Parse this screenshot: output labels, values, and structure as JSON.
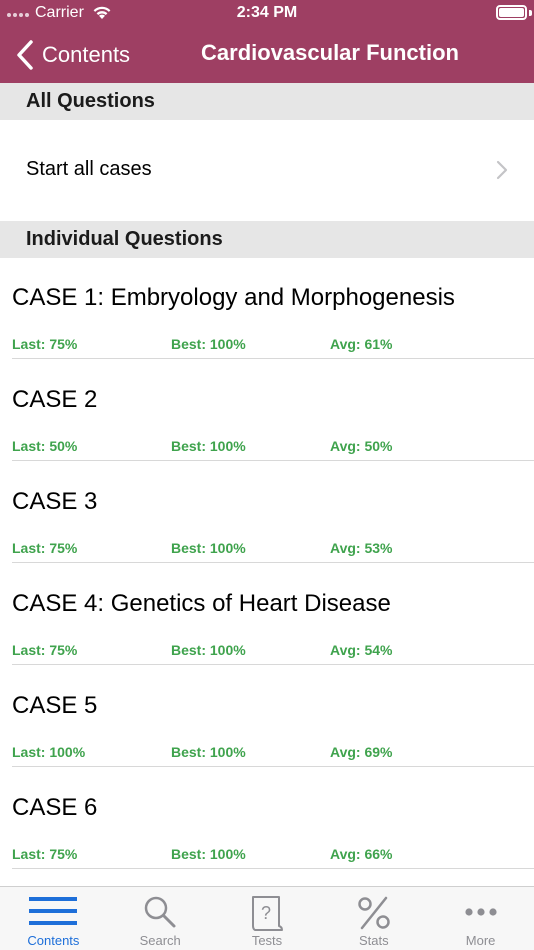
{
  "status_bar": {
    "carrier": "Carrier",
    "time": "2:34 PM"
  },
  "nav": {
    "back_label": "Contents",
    "title": "Cardiovascular Function"
  },
  "sections": {
    "all_questions": "All Questions",
    "individual_questions": "Individual Questions"
  },
  "start_all": {
    "label": "Start all cases"
  },
  "cases": [
    {
      "title": "CASE 1: Embryology and Morphogenesis",
      "last": "Last: 75%",
      "best": "Best: 100%",
      "avg": "Avg: 61%"
    },
    {
      "title": "CASE 2",
      "last": "Last: 50%",
      "best": "Best: 100%",
      "avg": "Avg: 50%"
    },
    {
      "title": "CASE 3",
      "last": "Last: 75%",
      "best": "Best: 100%",
      "avg": "Avg: 53%"
    },
    {
      "title": "CASE 4: Genetics of Heart Disease",
      "last": "Last: 75%",
      "best": "Best: 100%",
      "avg": "Avg: 54%"
    },
    {
      "title": "CASE 5",
      "last": "Last: 100%",
      "best": "Best: 100%",
      "avg": "Avg: 69%"
    },
    {
      "title": "CASE 6",
      "last": "Last: 75%",
      "best": "Best: 100%",
      "avg": "Avg: 66%"
    }
  ],
  "tabs": [
    {
      "label": "Contents",
      "icon": "list-icon",
      "active": true
    },
    {
      "label": "Search",
      "icon": "search-icon",
      "active": false
    },
    {
      "label": "Tests",
      "icon": "test-icon",
      "active": false
    },
    {
      "label": "Stats",
      "icon": "percent-icon",
      "active": false
    },
    {
      "label": "More",
      "icon": "more-icon",
      "active": false
    }
  ],
  "colors": {
    "nav_background": "#9e3f63",
    "stat_green": "#3fa34d",
    "tab_active": "#1e6fd9",
    "tab_inactive": "#8e8e93",
    "section_header_bg": "#e6e6e6"
  }
}
